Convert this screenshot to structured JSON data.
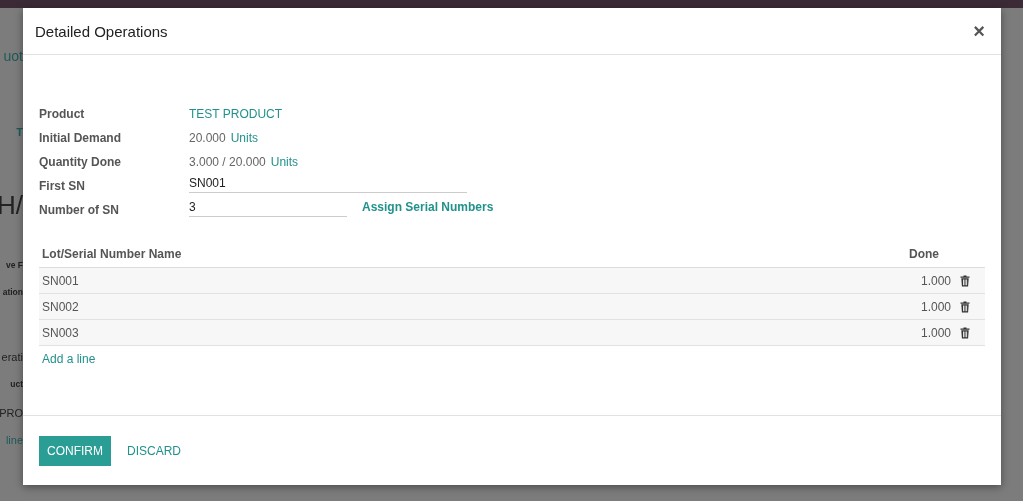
{
  "background": {
    "fragments": [
      {
        "kind": "title",
        "text": "uot"
      },
      {
        "kind": "button",
        "text": "T"
      },
      {
        "kind": "heading",
        "text": "H/"
      },
      {
        "kind": "label",
        "text": "ve F"
      },
      {
        "kind": "label",
        "text": "ation"
      },
      {
        "kind": "tab",
        "text": "erati"
      },
      {
        "kind": "label",
        "text": "uct"
      },
      {
        "kind": "cell",
        "text": "PRO"
      },
      {
        "kind": "link",
        "text": "line"
      }
    ]
  },
  "dialog": {
    "title": "Detailed Operations",
    "close": "×",
    "fields": [
      {
        "label": "Product",
        "kind": "link",
        "value": "TEST PRODUCT"
      },
      {
        "label": "Initial Demand",
        "kind": "quantity",
        "value": "20.000",
        "unit": "Units"
      },
      {
        "label": "Quantity Done",
        "kind": "quantity",
        "value": "3.000  /  20.000",
        "unit": "Units"
      },
      {
        "label": "First SN",
        "kind": "input",
        "value": "SN001"
      },
      {
        "label": "Number of SN",
        "kind": "input_action",
        "value": "3",
        "action": "Assign Serial Numbers"
      }
    ],
    "table": {
      "columns": [
        "Lot/Serial Number Name",
        "Done"
      ],
      "rows": [
        {
          "name": "SN001",
          "done": "1.000"
        },
        {
          "name": "SN002",
          "done": "1.000"
        },
        {
          "name": "SN003",
          "done": "1.000"
        }
      ],
      "add_line": "Add a line"
    },
    "buttons": [
      {
        "kind": "primary",
        "label": "CONFIRM"
      },
      {
        "kind": "link",
        "label": "DISCARD"
      }
    ]
  }
}
